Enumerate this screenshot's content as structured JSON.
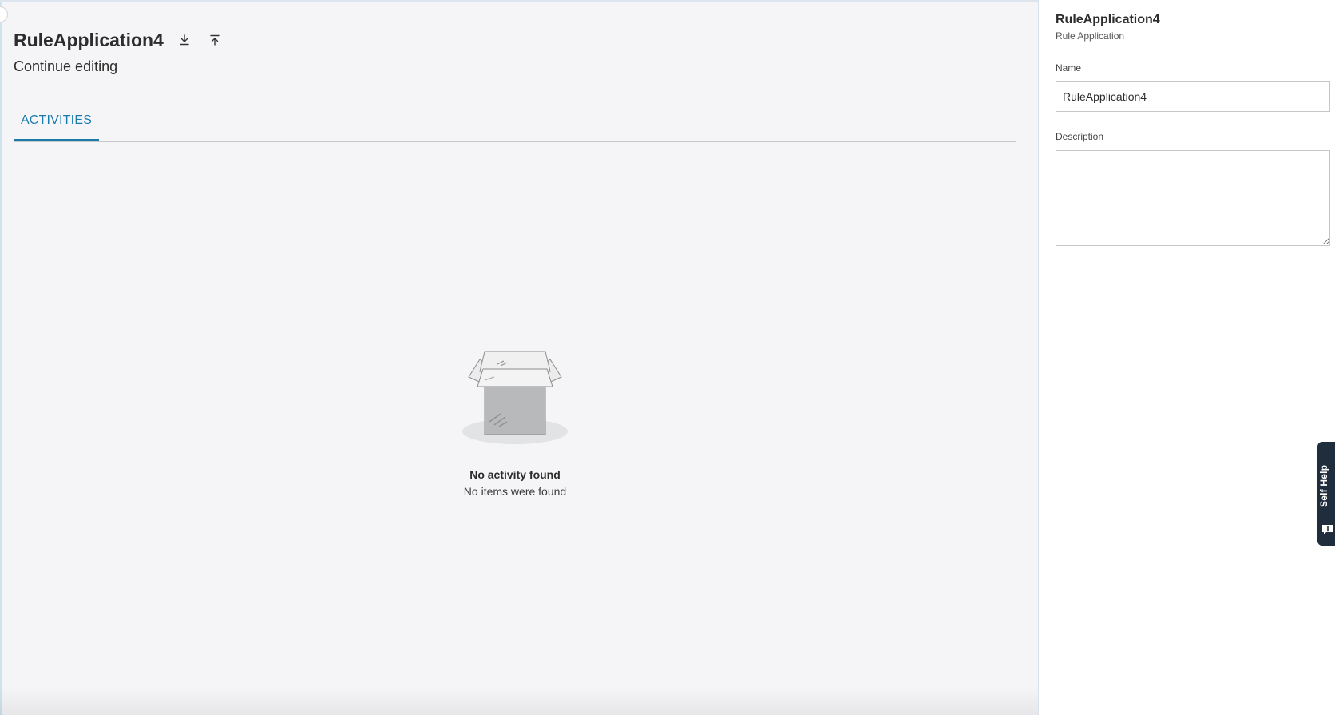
{
  "main": {
    "title": "RuleApplication4",
    "subtitle": "Continue editing",
    "actions": {
      "download_icon": "download-icon",
      "upload_icon": "upload-icon"
    },
    "tabs": [
      {
        "label": "ACTIVITIES",
        "active": true
      }
    ],
    "empty_state": {
      "title": "No activity found",
      "message": "No items were found",
      "illustration_icon": "empty-box-icon"
    }
  },
  "panel": {
    "title": "RuleApplication4",
    "subtitle": "Rule Application",
    "name_label": "Name",
    "name_value": "RuleApplication4",
    "description_label": "Description",
    "description_value": ""
  },
  "self_help": {
    "label": "Self Help",
    "icon": "feedback-icon"
  },
  "colors": {
    "accent": "#1a7bab",
    "background": "#f5f5f7",
    "self_help_bg": "#1f2d3d"
  }
}
